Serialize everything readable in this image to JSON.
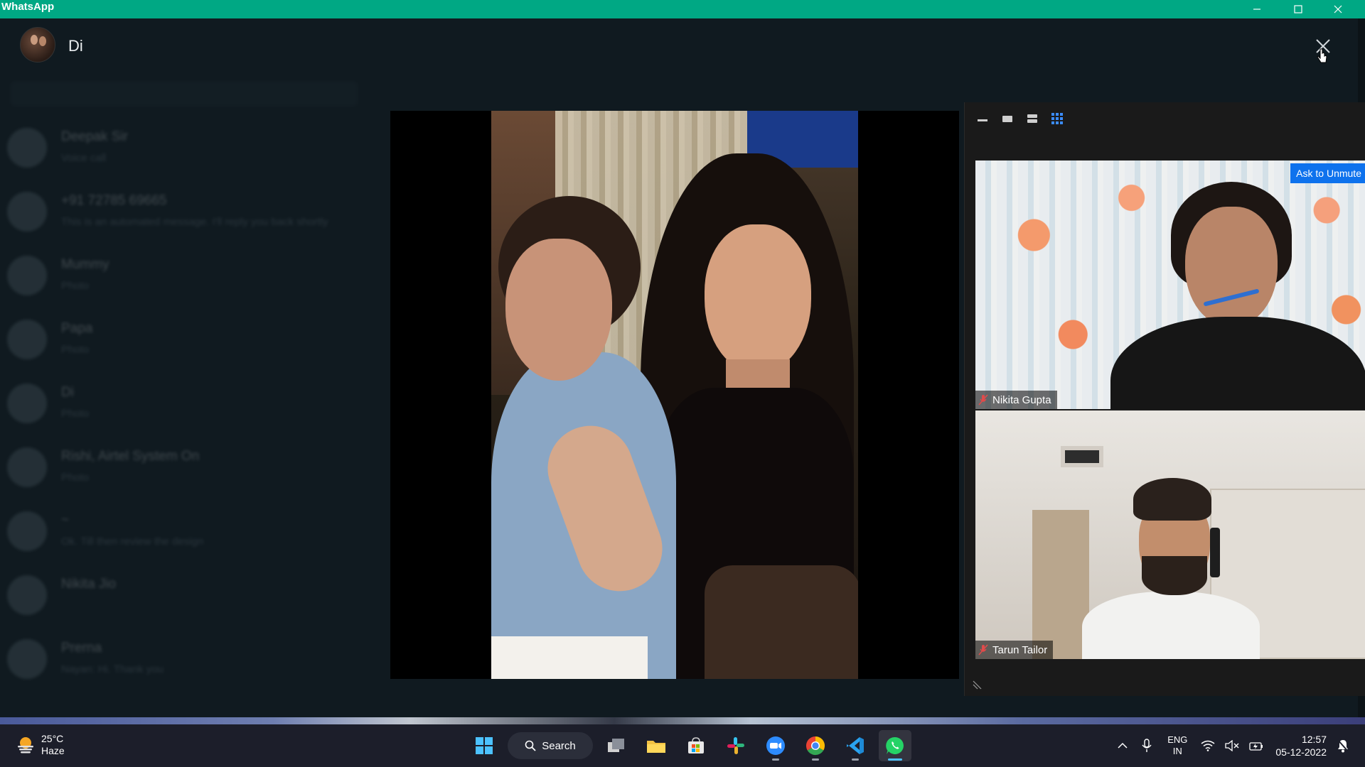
{
  "window": {
    "title": "WhatsApp"
  },
  "viewer": {
    "contact_name": "Di"
  },
  "background_chats": [
    {
      "name": "Deepak Sir",
      "preview": "Voice call"
    },
    {
      "name": "+91 72785 69665",
      "preview": "This is an automated message. I'll reply you back shortly"
    },
    {
      "name": "Mummy",
      "preview": "Photo"
    },
    {
      "name": "Papa",
      "preview": "Photo"
    },
    {
      "name": "Di",
      "preview": "Photo"
    },
    {
      "name": "Rishi, Airtel System On",
      "preview": "Photo"
    },
    {
      "name": "~",
      "preview": "Ok. Till then review the design"
    },
    {
      "name": "Nikita Jio",
      "preview": ""
    },
    {
      "name": "Prerna",
      "preview": "Nayan: Hi. Thank you"
    }
  ],
  "zoom": {
    "ask_unmute_label": "Ask to Unmute",
    "participants": [
      {
        "name": "Nikita Gupta"
      },
      {
        "name": "Tarun Tailor"
      }
    ]
  },
  "taskbar": {
    "weather": {
      "temp": "25°C",
      "condition": "Haze"
    },
    "search_label": "Search",
    "language": {
      "line1": "ENG",
      "line2": "IN"
    },
    "clock": {
      "time": "12:57",
      "date": "05-12-2022"
    }
  },
  "colors": {
    "titlebar": "#00a884",
    "zoom_blue": "#0e72ed",
    "viewer_bg": "#111b21"
  }
}
